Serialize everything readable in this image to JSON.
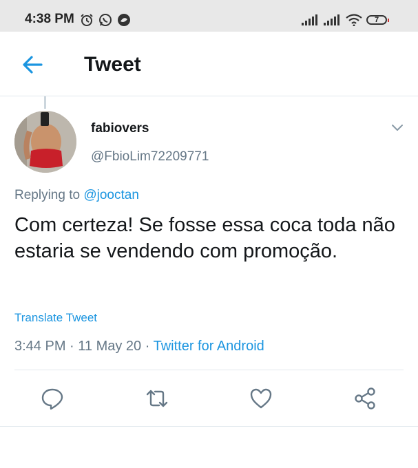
{
  "status_bar": {
    "time": "4:38 PM",
    "battery": "7",
    "icons": [
      "alarm-icon",
      "whatsapp-icon",
      "music-icon",
      "signal-icon",
      "signal-icon",
      "wifi-icon",
      "battery-icon"
    ]
  },
  "app_bar": {
    "back_icon": "back-arrow-icon",
    "title": "Tweet"
  },
  "tweet": {
    "author": {
      "display_name": "fabiovers",
      "handle": "@FbioLim72209771"
    },
    "replying_prefix": "Replying to ",
    "replying_to": "@jooctan",
    "text": "Com certeza! Se fosse essa coca toda não estaria se vendendo com promoção.",
    "translate_label": "Translate Tweet",
    "timestamp": "3:44 PM · 11 May 20 · ",
    "source": "Twitter for Android"
  },
  "actions": [
    "reply-icon",
    "retweet-icon",
    "like-icon",
    "share-icon"
  ],
  "colors": {
    "accent": "#1b95e0",
    "secondary_text": "#657786",
    "primary_text": "#14171a",
    "divider": "#e1e8ed",
    "status_bar_bg": "#e8e8e8"
  }
}
